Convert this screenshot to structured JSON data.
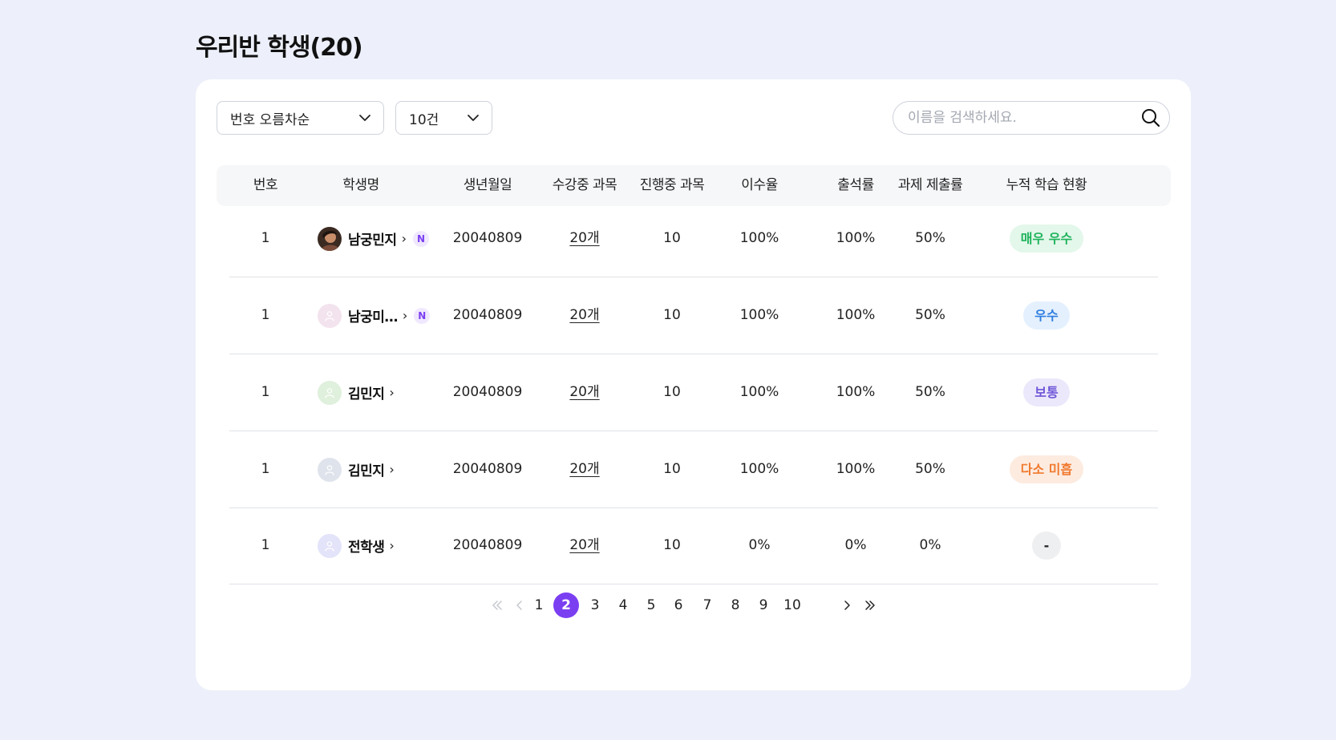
{
  "page": {
    "title": "우리반 학생(20)"
  },
  "filters": {
    "sort_label": "번호 오름차순",
    "size_label": "10건"
  },
  "search": {
    "placeholder": "이름을 검색하세요."
  },
  "table": {
    "headers": [
      "번호",
      "학생명",
      "생년월일",
      "수강중 과목",
      "진행중 과목",
      "이수율",
      "출석률",
      "과제 제출률",
      "누적 학습 현황"
    ],
    "rows": [
      {
        "no": "1",
        "name": "남궁민지",
        "arrow": "›",
        "new_badge": "N",
        "birth": "20040809",
        "enrolled": "20개",
        "in_progress": "10",
        "completion": "100%",
        "attendance": "100%",
        "assignment": "50%",
        "status": "매우 우수",
        "avatar": "photo"
      },
      {
        "no": "1",
        "name": "남궁미…",
        "arrow": "›",
        "new_badge": "N",
        "birth": "20040809",
        "enrolled": "20개",
        "in_progress": "10",
        "completion": "100%",
        "attendance": "100%",
        "assignment": "50%",
        "status": "우수",
        "avatar": "default-pink"
      },
      {
        "no": "1",
        "name": "김민지",
        "arrow": "›",
        "birth": "20040809",
        "enrolled": "20개",
        "in_progress": "10",
        "completion": "100%",
        "attendance": "100%",
        "assignment": "50%",
        "status": "보통",
        "avatar": "default-green"
      },
      {
        "no": "1",
        "name": "김민지",
        "arrow": "›",
        "birth": "20040809",
        "enrolled": "20개",
        "in_progress": "10",
        "completion": "100%",
        "attendance": "100%",
        "assignment": "50%",
        "status": "다소 미흡",
        "avatar": "default-gray"
      },
      {
        "no": "1",
        "name": "전학생",
        "arrow": "›",
        "birth": "20040809",
        "enrolled": "20개",
        "in_progress": "10",
        "completion": "0%",
        "attendance": "0%",
        "assignment": "0%",
        "status": "-",
        "avatar": "default-purple"
      }
    ]
  },
  "status_styles": {
    "매우 우수": {
      "bg": "#e3f7ea",
      "fg": "#1fb35c"
    },
    "우수": {
      "bg": "#e4f0fd",
      "fg": "#2f7de0"
    },
    "보통": {
      "bg": "#ece8fb",
      "fg": "#6e55d8"
    },
    "다소 미흡": {
      "bg": "#fdebe0",
      "fg": "#f07a2f"
    },
    "-": {
      "bg": "#eeeff1",
      "fg": "#222222"
    }
  },
  "avatar_colors": {
    "default-pink": "#f3e3ee",
    "default-green": "#dff0dc",
    "default-gray": "#dfe3ec",
    "default-purple": "#e3e3fa"
  },
  "pagination": {
    "pages": [
      "1",
      "2",
      "3",
      "4",
      "5",
      "6",
      "7",
      "8",
      "9",
      "10"
    ],
    "current": "2"
  },
  "icons": {
    "sort_select": "chevron-down-icon",
    "size_select": "chevron-down-icon",
    "search": "search-icon",
    "first": "double-chevron-left-icon",
    "prev": "chevron-left-icon",
    "next": "chevron-right-icon",
    "last": "double-chevron-right-icon"
  },
  "colors": {
    "accent": "#7b3ff2",
    "background": "#edf0fa",
    "new_badge": "#7b3ff2"
  }
}
